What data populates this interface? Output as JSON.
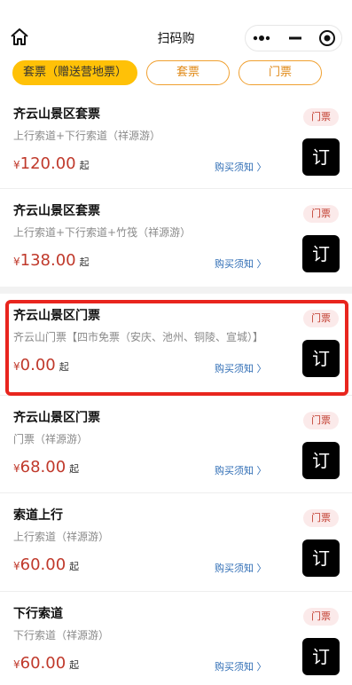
{
  "header": {
    "title": "扫码购",
    "icons": {
      "home": "home-icon",
      "more": "more-dots-icon",
      "minimize": "minimize-icon",
      "close": "target-close-icon"
    }
  },
  "tabs": [
    {
      "label": "套票（赠送营地票）",
      "active": true
    },
    {
      "label": "套票",
      "active": false
    },
    {
      "label": "门票",
      "active": false
    }
  ],
  "colors": {
    "accent": "#ffc107",
    "tab_border": "#f0a030",
    "price": "#c0392b",
    "link": "#2f6db5",
    "highlight": "#e8251e"
  },
  "items": [
    {
      "name": "齐云山景区套票",
      "desc": "上行索道+下行索道（祥源游）",
      "yen": "¥",
      "amount": "120.00",
      "suffix": "起",
      "notice": "购买须知 〉",
      "badge": "门票",
      "order": "订"
    },
    {
      "name": "齐云山景区套票",
      "desc": "上行索道+下行索道+竹筏（祥源游）",
      "yen": "¥",
      "amount": "138.00",
      "suffix": "起",
      "notice": "购买须知 〉",
      "badge": "门票",
      "order": "订"
    },
    {
      "name": "齐云山景区门票",
      "desc": "齐云山门票【四市免票（安庆、池州、铜陵、宣城）】",
      "yen": "¥",
      "amount": "0.00",
      "suffix": "起",
      "notice": "购买须知 〉",
      "badge": "门票",
      "order": "订"
    },
    {
      "name": "齐云山景区门票",
      "desc": "门票（祥源游）",
      "yen": "¥",
      "amount": "68.00",
      "suffix": "起",
      "notice": "购买须知 〉",
      "badge": "门票",
      "order": "订"
    },
    {
      "name": "索道上行",
      "desc": "上行索道（祥源游）",
      "yen": "¥",
      "amount": "60.00",
      "suffix": "起",
      "notice": "购买须知 〉",
      "badge": "门票",
      "order": "订"
    },
    {
      "name": "下行索道",
      "desc": "下行索道（祥源游）",
      "yen": "¥",
      "amount": "60.00",
      "suffix": "起",
      "notice": "购买须知 〉",
      "badge": "门票",
      "order": "订"
    }
  ]
}
